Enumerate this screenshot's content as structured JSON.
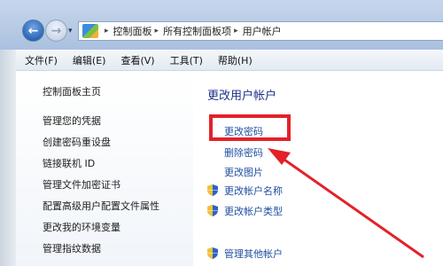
{
  "address": {
    "crumbs": [
      "控制面板",
      "所有控制面板项",
      "用户帐户"
    ]
  },
  "menu": [
    "文件(F)",
    "编辑(E)",
    "查看(V)",
    "工具(T)",
    "帮助(H)"
  ],
  "sidebar": {
    "items": [
      "控制面板主页",
      "管理您的凭据",
      "创建密码重设盘",
      "链接联机 ID",
      "管理文件加密证书",
      "配置高级用户配置文件属性",
      "更改我的环境变量",
      "管理指纹数据"
    ]
  },
  "main": {
    "title": "更改用户帐户",
    "tasks": [
      "更改密码",
      "删除密码",
      "更改图片",
      "更改帐户名称",
      "更改帐户类型"
    ],
    "other": "管理其他帐户"
  },
  "colors": {
    "highlight": "#e3212b",
    "link": "#1f4fa0",
    "title": "#1e3287"
  }
}
